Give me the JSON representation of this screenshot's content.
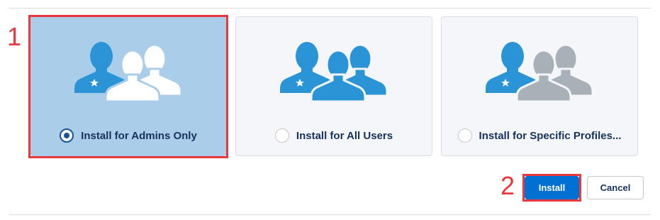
{
  "steps": {
    "first": "1",
    "second": "2"
  },
  "options": [
    {
      "label": "Install for Admins Only",
      "selected": true
    },
    {
      "label": "Install for All Users",
      "selected": false
    },
    {
      "label": "Install for Specific Profiles...",
      "selected": false
    }
  ],
  "icons": {
    "admin_figure": "admin-user-icon",
    "group_figure": "users-group-icon"
  },
  "buttons": {
    "install": "Install",
    "cancel": "Cancel"
  },
  "colors": {
    "accent": "#0070d2",
    "selected_card": "#aacde9",
    "admin_figure": "#2a94d6",
    "annotation": "#e8383d",
    "inactive_figure": "#a8b0b8"
  }
}
